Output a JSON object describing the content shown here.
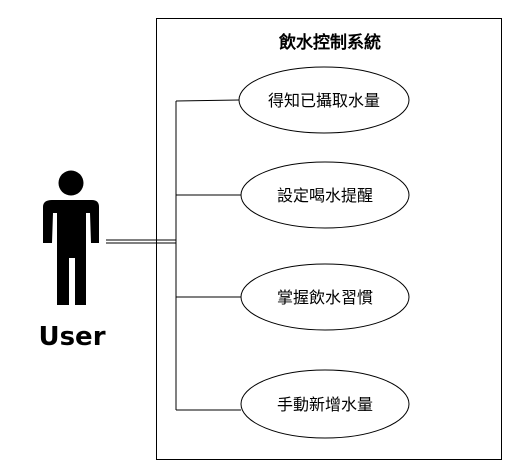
{
  "diagram": {
    "system": {
      "title": "飲水控制系統"
    },
    "actor": {
      "label": "User",
      "icon": "person-icon"
    },
    "use_cases": [
      {
        "label": "得知已攝取水量"
      },
      {
        "label": "設定喝水提醒"
      },
      {
        "label": "掌握飲水習慣"
      },
      {
        "label": "手動新增水量"
      }
    ]
  }
}
